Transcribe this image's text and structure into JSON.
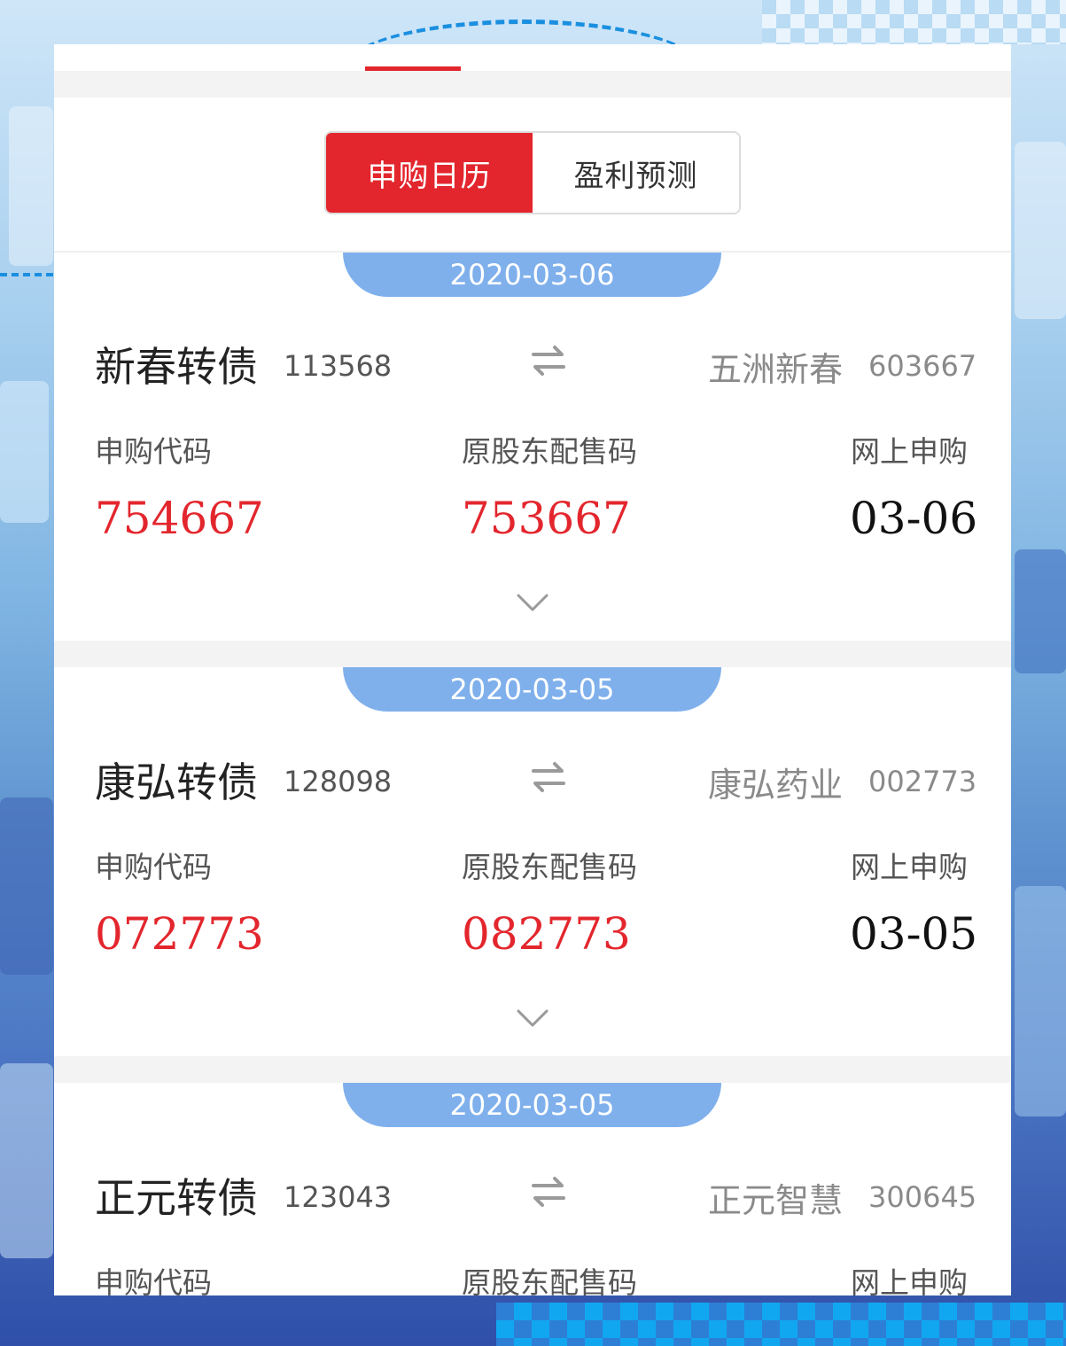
{
  "segments": {
    "calendar": "申购日历",
    "forecast": "盈利预测"
  },
  "colors": {
    "accent": "#e3262d",
    "date_pill": "#7fb0ec"
  },
  "labels": {
    "sub_code": "申购代码",
    "placement_code": "原股东配售码",
    "online_sub": "网上申购"
  },
  "bonds": [
    {
      "date": "2020-03-06",
      "name": "新春转债",
      "code": "113568",
      "stock_name": "五洲新春",
      "stock_code": "603667",
      "sub_code": "754667",
      "placement_code": "753667",
      "online_date": "03-06"
    },
    {
      "date": "2020-03-05",
      "name": "康弘转债",
      "code": "128098",
      "stock_name": "康弘药业",
      "stock_code": "002773",
      "sub_code": "072773",
      "placement_code": "082773",
      "online_date": "03-05"
    },
    {
      "date": "2020-03-05",
      "name": "正元转债",
      "code": "123043",
      "stock_name": "正元智慧",
      "stock_code": "300645"
    }
  ]
}
